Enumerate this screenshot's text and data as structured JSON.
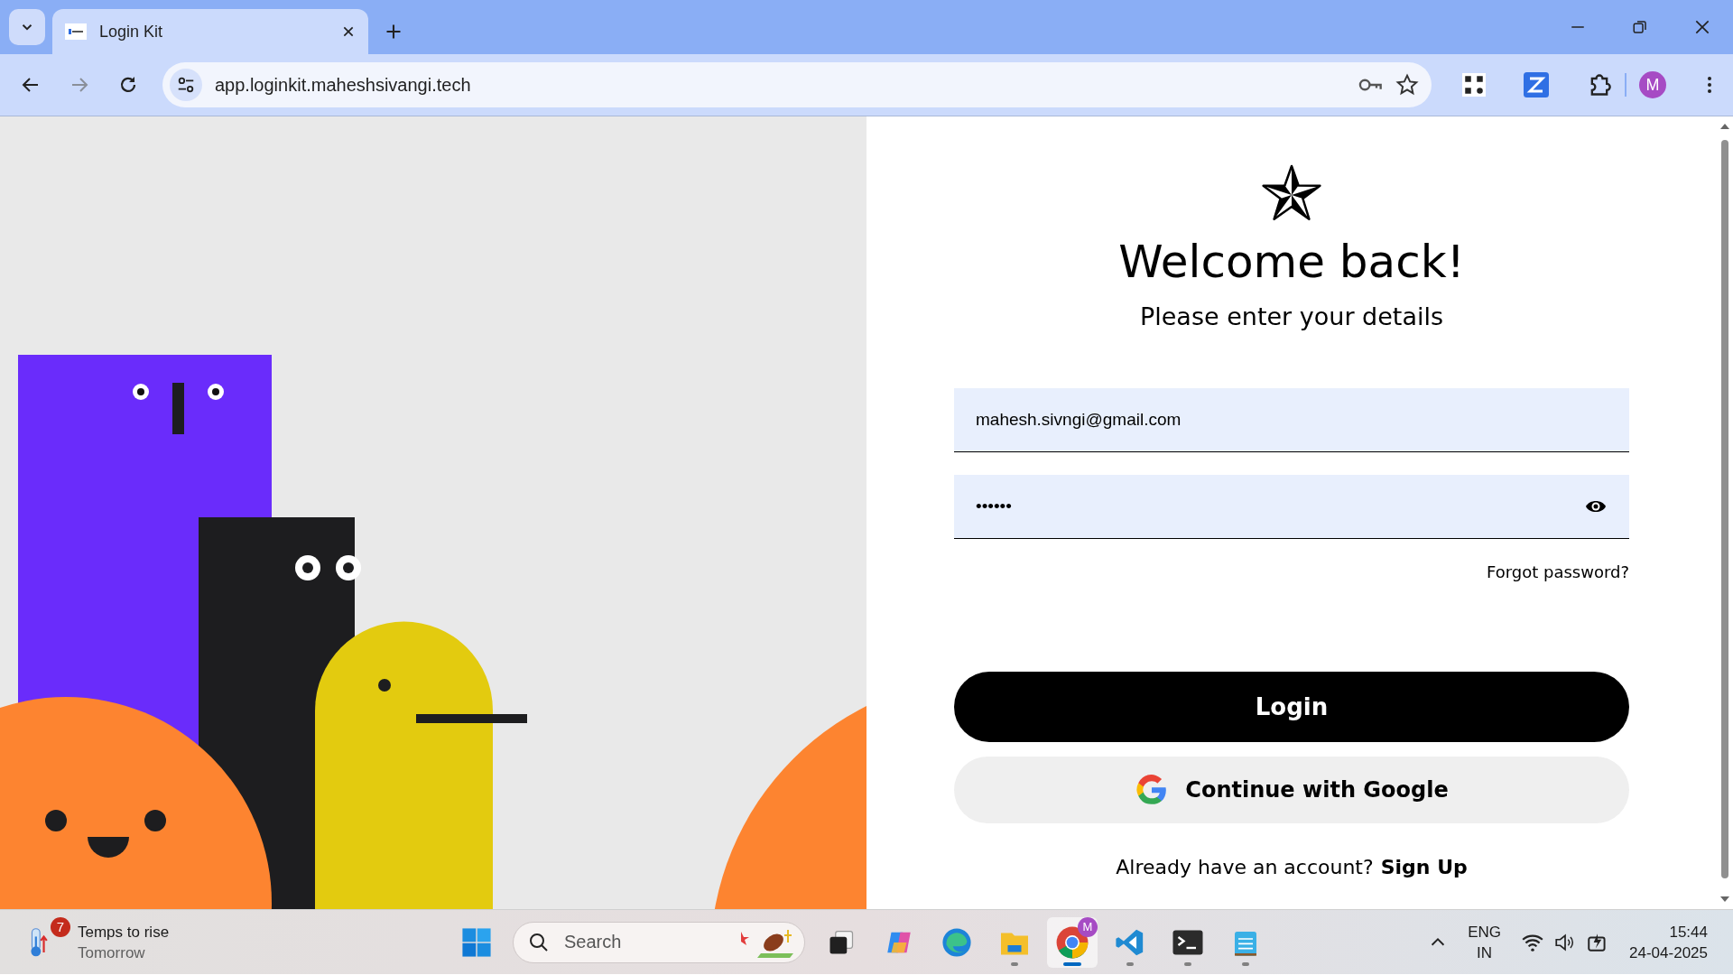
{
  "browser": {
    "tab": {
      "title": "Login Kit",
      "selected": true
    },
    "address": "app.loginkit.maheshsivangi.tech",
    "profile_initial": "M"
  },
  "login": {
    "heading": "Welcome back!",
    "subheading": "Please enter your details",
    "email": {
      "value": "mahesh.sivngi@gmail.com"
    },
    "password": {
      "value": "••••••"
    },
    "forgot_link": "Forgot password?",
    "login_button": "Login",
    "google_button": "Continue with Google",
    "signup_prompt": "Already have an account?",
    "signup_link": "Sign Up"
  },
  "taskbar": {
    "weather": {
      "badge": "7",
      "title": "Temps to rise",
      "subtitle": "Tomorrow"
    },
    "search": {
      "placeholder": "Search"
    },
    "apps": [
      {
        "kind": "start",
        "running": false,
        "selected": false
      },
      {
        "kind": "taskview",
        "running": false,
        "selected": false
      },
      {
        "kind": "copilot",
        "running": false,
        "selected": false
      },
      {
        "kind": "edge",
        "running": false,
        "selected": false
      },
      {
        "kind": "files",
        "running": true,
        "selected": false
      },
      {
        "kind": "chrome",
        "running": true,
        "selected": true,
        "badge": "M"
      },
      {
        "kind": "vscode",
        "running": true,
        "selected": false
      },
      {
        "kind": "terminal",
        "running": true,
        "selected": false
      },
      {
        "kind": "notepad",
        "running": true,
        "selected": false
      }
    ],
    "language": {
      "line1": "ENG",
      "line2": "IN"
    },
    "clock": {
      "time": "15:44",
      "date": "24-04-2025"
    }
  }
}
